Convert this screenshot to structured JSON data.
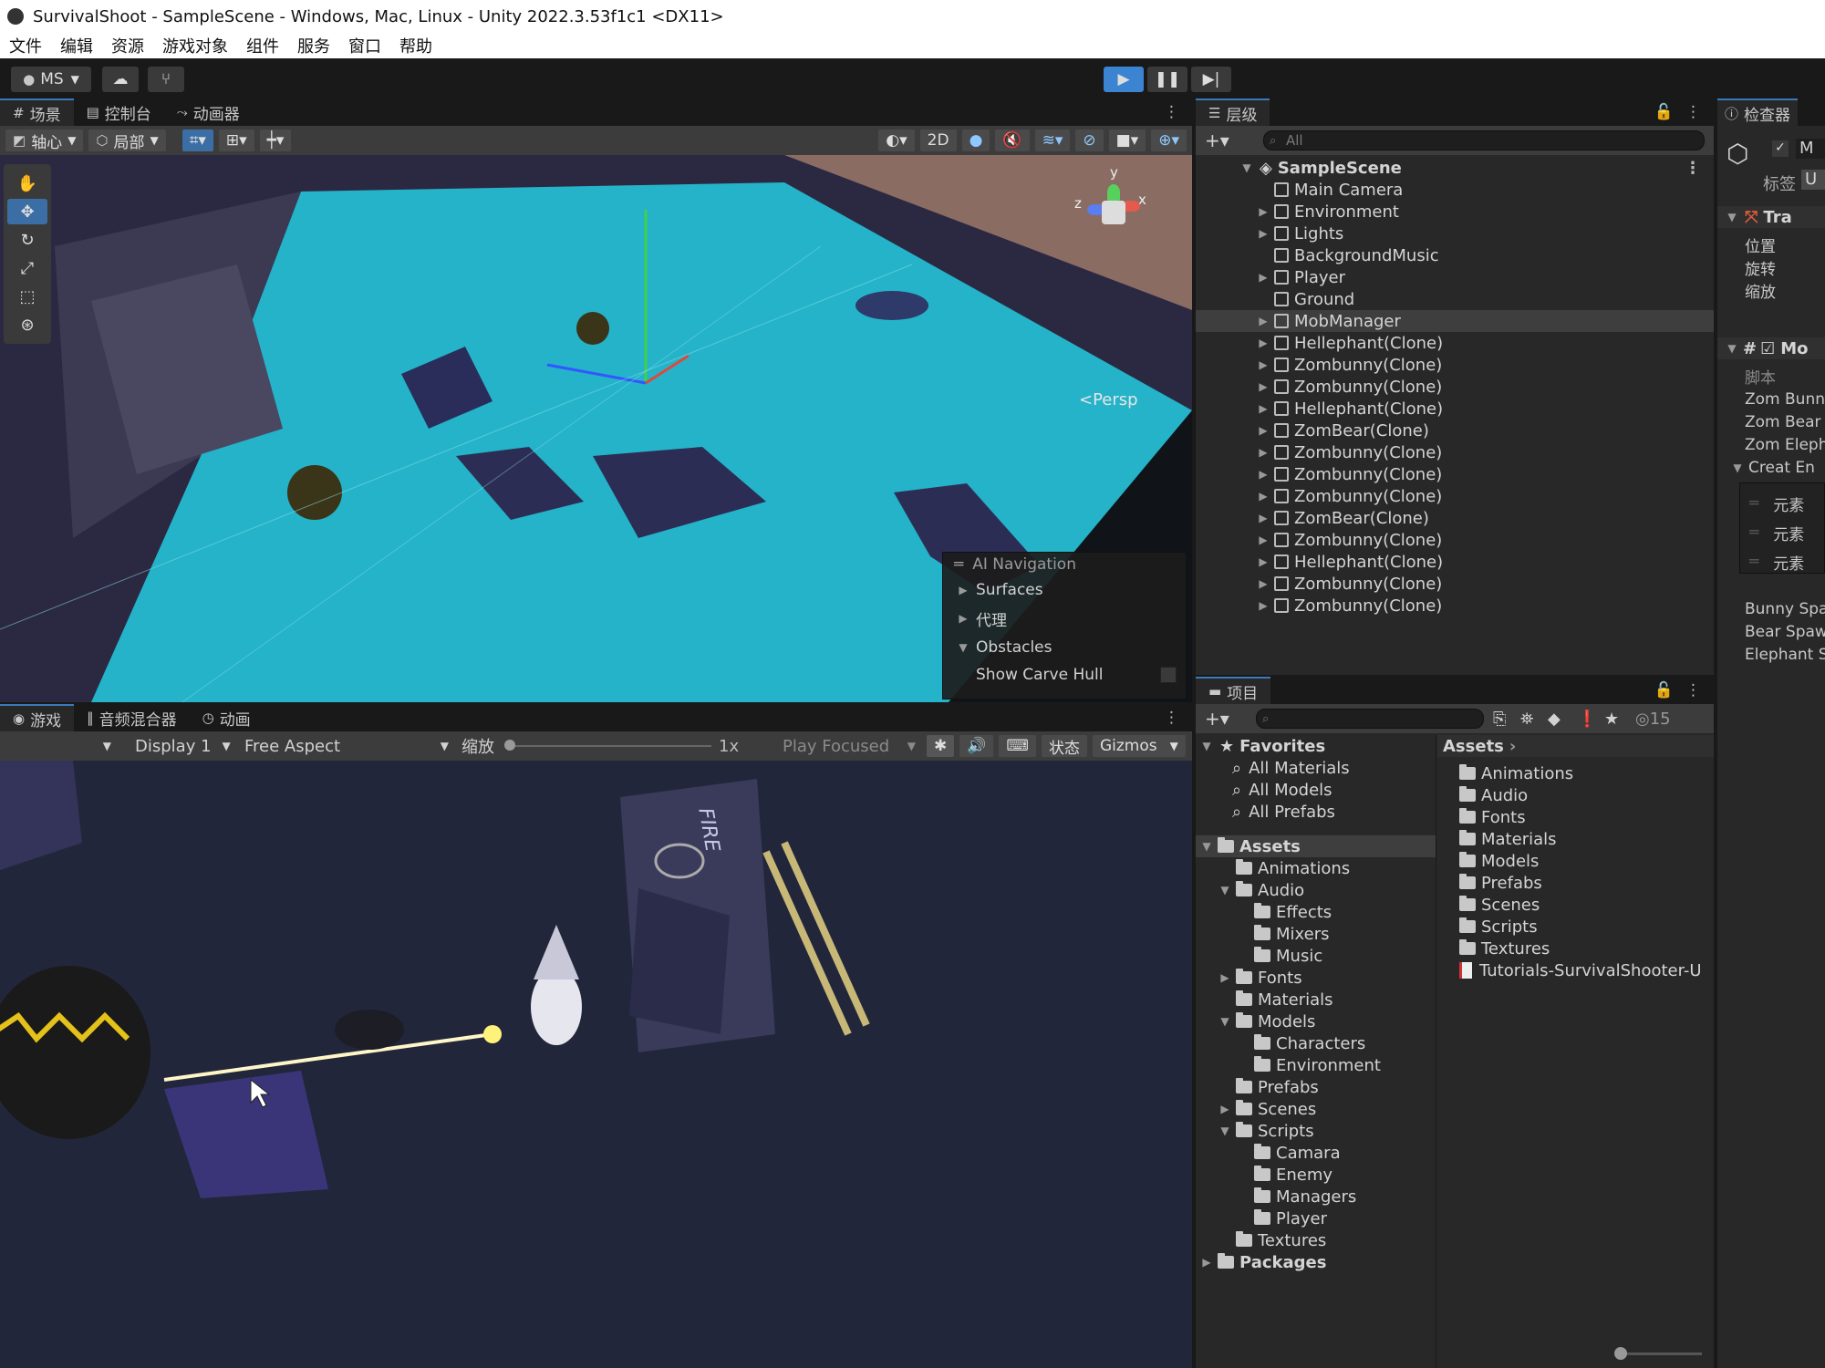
{
  "window": {
    "title": "SurvivalShoot - SampleScene - Windows, Mac, Linux - Unity 2022.3.53f1c1 <DX11>"
  },
  "menu": [
    "文件",
    "编辑",
    "资源",
    "游戏对象",
    "组件",
    "服务",
    "窗口",
    "帮助"
  ],
  "toolbar": {
    "account": "MS",
    "account_icon": "user-icon",
    "cloud_icon": "cloud-icon",
    "collab_icon": "version-control-icon"
  },
  "scene_panel": {
    "tabs": [
      "场景",
      "控制台",
      "动画器"
    ],
    "pivot_label": "轴心",
    "space_label": "局部",
    "mode_2d": "2D",
    "persp_label": "<Persp",
    "gizmo_axes": [
      "y",
      "x",
      "z"
    ],
    "ai_nav": {
      "title": "AI Navigation",
      "items": [
        "Surfaces",
        "代理",
        "Obstacles"
      ],
      "show_carve_hull": "Show Carve Hull"
    }
  },
  "game_panel": {
    "tabs": [
      "游戏",
      "音频混合器",
      "动画"
    ],
    "display": "Display 1",
    "aspect": "Free Aspect",
    "scale_label": "缩放",
    "scale_value": "1x",
    "play_focused": "Play Focused",
    "stats": "状态",
    "gizmos": "Gizmos",
    "fire_text": "FIRE"
  },
  "hierarchy": {
    "tab": "层级",
    "search_placeholder": "All",
    "scene": "SampleScene",
    "items": [
      {
        "label": "Main Camera",
        "expandable": false
      },
      {
        "label": "Environment",
        "expandable": true
      },
      {
        "label": "Lights",
        "expandable": true
      },
      {
        "label": "BackgroundMusic",
        "expandable": false
      },
      {
        "label": "Player",
        "expandable": true
      },
      {
        "label": "Ground",
        "expandable": false
      },
      {
        "label": "MobManager",
        "expandable": true,
        "selected": true
      },
      {
        "label": "Hellephant(Clone)",
        "expandable": true
      },
      {
        "label": "Zombunny(Clone)",
        "expandable": true
      },
      {
        "label": "Zombunny(Clone)",
        "expandable": true
      },
      {
        "label": "Hellephant(Clone)",
        "expandable": true
      },
      {
        "label": "ZomBear(Clone)",
        "expandable": true
      },
      {
        "label": "Zombunny(Clone)",
        "expandable": true
      },
      {
        "label": "Zombunny(Clone)",
        "expandable": true
      },
      {
        "label": "Zombunny(Clone)",
        "expandable": true
      },
      {
        "label": "ZomBear(Clone)",
        "expandable": true
      },
      {
        "label": "Zombunny(Clone)",
        "expandable": true
      },
      {
        "label": "Hellephant(Clone)",
        "expandable": true
      },
      {
        "label": "Zombunny(Clone)",
        "expandable": true
      },
      {
        "label": "Zombunny(Clone)",
        "expandable": true
      }
    ]
  },
  "project": {
    "tab": "项目",
    "hidden_count": "15",
    "favorites_label": "Favorites",
    "favorites": [
      "All Materials",
      "All Models",
      "All Prefabs"
    ],
    "tree": [
      {
        "label": "Assets",
        "level": 0,
        "arrow": "▼",
        "bold": true,
        "selected": true
      },
      {
        "label": "Animations",
        "level": 1,
        "arrow": ""
      },
      {
        "label": "Audio",
        "level": 1,
        "arrow": "▼",
        "open": true
      },
      {
        "label": "Effects",
        "level": 2,
        "arrow": ""
      },
      {
        "label": "Mixers",
        "level": 2,
        "arrow": ""
      },
      {
        "label": "Music",
        "level": 2,
        "arrow": ""
      },
      {
        "label": "Fonts",
        "level": 1,
        "arrow": "▶"
      },
      {
        "label": "Materials",
        "level": 1,
        "arrow": ""
      },
      {
        "label": "Models",
        "level": 1,
        "arrow": "▼",
        "open": true
      },
      {
        "label": "Characters",
        "level": 2,
        "arrow": ""
      },
      {
        "label": "Environment",
        "level": 2,
        "arrow": ""
      },
      {
        "label": "Prefabs",
        "level": 1,
        "arrow": ""
      },
      {
        "label": "Scenes",
        "level": 1,
        "arrow": "▶"
      },
      {
        "label": "Scripts",
        "level": 1,
        "arrow": "▼",
        "open": true
      },
      {
        "label": "Camara",
        "level": 2,
        "arrow": ""
      },
      {
        "label": "Enemy",
        "level": 2,
        "arrow": ""
      },
      {
        "label": "Managers",
        "level": 2,
        "arrow": ""
      },
      {
        "label": "Player",
        "level": 2,
        "arrow": ""
      },
      {
        "label": "Textures",
        "level": 1,
        "arrow": ""
      },
      {
        "label": "Packages",
        "level": 0,
        "arrow": "▶",
        "bold": true
      }
    ],
    "breadcrumb": "Assets",
    "assets": [
      "Animations",
      "Audio",
      "Fonts",
      "Materials",
      "Models",
      "Prefabs",
      "Scenes",
      "Scripts",
      "Textures"
    ],
    "file": "Tutorials-SurvivalShooter-U"
  },
  "inspector": {
    "tab": "检查器",
    "name_prefix": "M",
    "tag_label": "标签",
    "tag_value": "U",
    "transform": "Tra",
    "position": "位置",
    "rotation": "旋转",
    "scale": "缩放",
    "script_component": "Mo",
    "script_label": "脚本",
    "fields": [
      "Zom Bunny",
      "Zom Bear I",
      "Zom Eleph"
    ],
    "list_label": "Creat En",
    "elements": [
      "元素",
      "元素",
      "元素"
    ],
    "spawns": [
      "Bunny Spa",
      "Bear Spaw",
      "Elephant S"
    ]
  }
}
